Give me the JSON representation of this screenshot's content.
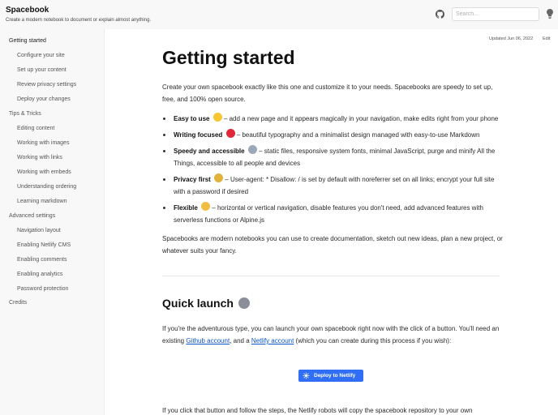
{
  "header": {
    "title": "Spacebook",
    "subtitle": "Create a modern notebook to document or explain almost anything.",
    "search_placeholder": "Search..."
  },
  "sidebar": {
    "items": [
      {
        "label": "Getting started",
        "level": 0,
        "active": true
      },
      {
        "label": "Configure your site",
        "level": 1
      },
      {
        "label": "Set up your content",
        "level": 1
      },
      {
        "label": "Review privacy settings",
        "level": 1
      },
      {
        "label": "Deploy your changes",
        "level": 1
      },
      {
        "label": "Tips & Tricks",
        "level": 0
      },
      {
        "label": "Editing content",
        "level": 1
      },
      {
        "label": "Working with images",
        "level": 1
      },
      {
        "label": "Working with links",
        "level": 1
      },
      {
        "label": "Working with embeds",
        "level": 1
      },
      {
        "label": "Understanding ordering",
        "level": 1
      },
      {
        "label": "Learning markdown",
        "level": 1
      },
      {
        "label": "Advanced settings",
        "level": 0
      },
      {
        "label": "Navigation layout",
        "level": 1
      },
      {
        "label": "Enabling Netlify CMS",
        "level": 1
      },
      {
        "label": "Enabling comments",
        "level": 1
      },
      {
        "label": "Enabling analytics",
        "level": 1
      },
      {
        "label": "Password protection",
        "level": 1
      },
      {
        "label": "Credits",
        "level": 0
      }
    ]
  },
  "meta": {
    "updated": "Updated Jun 06, 2022",
    "edit": "Edit"
  },
  "main": {
    "title": "Getting started",
    "intro": "Create your own spacebook exactly like this one and customize it to your needs. Spacebooks are speedy to set up, free, and 100% open source.",
    "bullets": [
      {
        "title": "Easy to use",
        "emoji": "smiley-emoji",
        "text": "– add a new page and it appears magically in your navigation, make edits right from your phone"
      },
      {
        "title": "Writing focused",
        "emoji": "heart-emoji",
        "text": "– beautiful typography and a minimalist design managed with easy-to-use Markdown"
      },
      {
        "title": "Speedy and accessible",
        "emoji": "rocket-emoji",
        "text": "– static files, responsive system fonts, minimal JavaScript, purge and minify All the Things, accessible to all people and devices"
      },
      {
        "title": "Privacy first",
        "emoji": "lock-emoji",
        "text": "– User-agent: * Disallow: / is set by default with noreferrer set on all links; encrypt your full site with a password if desired"
      },
      {
        "title": "Flexible",
        "emoji": "flexed-arm-emoji",
        "text": "– horizontal or vertical navigation, disable features you don't need, add advanced features with serverless functions or Alpine.js"
      }
    ],
    "outro": "Spacebooks are modern notebooks you can use to create documentation, sketch out new ideas, plan a new project, or whatever suits your fancy.",
    "quick_launch": {
      "heading": "Quick launch",
      "heading_emoji": "astronaut-emoji",
      "text_before": "If you're the adventurous type, you can launch your own spacebook right now with the click of a button. You'll need an existing ",
      "link_github": "Github account",
      "text_mid": ", and a ",
      "link_netlify": "Netlify account",
      "text_after": " (which you can create during this process if you wish):",
      "deploy_label": "Deploy to Netlify",
      "follow_up": "If you click that button and follow the steps, the Netlify robots will copy the spacebook repository to your own"
    }
  },
  "colors": {
    "accent_link": "#0a55c9",
    "deploy_button": "#2f6ef5",
    "sidebar_bg": "#f8f8f8"
  }
}
